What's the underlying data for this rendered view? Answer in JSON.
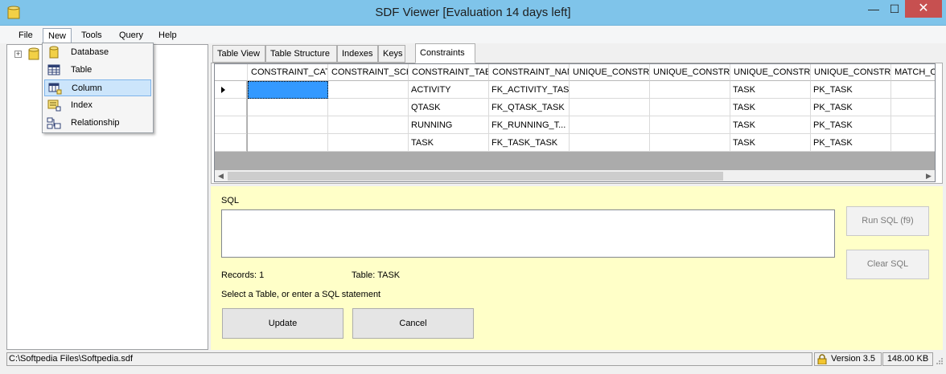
{
  "window": {
    "title": "SDF Viewer [Evaluation 14 days left]",
    "minimize": "—",
    "maximize": "☐",
    "close": "✕"
  },
  "menu": {
    "file": "File",
    "new": "New",
    "tools": "Tools",
    "query": "Query",
    "help": "Help"
  },
  "new_menu": {
    "items": [
      "Database",
      "Table",
      "Column",
      "Index",
      "Relationship"
    ],
    "highlighted": "Column"
  },
  "tree": {
    "expander": "+"
  },
  "tabs": [
    "Table View",
    "Table Structure",
    "Indexes",
    "Keys",
    "Constraints"
  ],
  "active_tab": "Constraints",
  "grid": {
    "columns": [
      "CONSTRAINT_CATALOG",
      "CONSTRAINT_SCHEMA",
      "CONSTRAINT_TABLE_NAME",
      "CONSTRAINT_NAME",
      "UNIQUE_CONSTRAINT_CATALOG",
      "UNIQUE_CONSTRAINT_SCHEMA",
      "UNIQUE_CONSTRAINT_TABLE_NAME",
      "UNIQUE_CONSTRAINT_NAME",
      "MATCH_OPTION"
    ],
    "rows": [
      [
        "",
        "",
        "ACTIVITY",
        "FK_ACTIVITY_TASK",
        "",
        "",
        "TASK",
        "PK_TASK",
        ""
      ],
      [
        "",
        "",
        "QTASK",
        "FK_QTASK_TASK",
        "",
        "",
        "TASK",
        "PK_TASK",
        ""
      ],
      [
        "",
        "",
        "RUNNING",
        "FK_RUNNING_T...",
        "",
        "",
        "TASK",
        "PK_TASK",
        ""
      ],
      [
        "",
        "",
        "TASK",
        "FK_TASK_TASK",
        "",
        "",
        "TASK",
        "PK_TASK",
        ""
      ]
    ],
    "scroll_left": "◀",
    "scroll_right": "▶"
  },
  "sql": {
    "label": "SQL",
    "value": "",
    "run_button": "Run SQL (f9)",
    "clear_button": "Clear SQL",
    "records": "Records: 1",
    "table": "Table: TASK",
    "hint": "Select a Table, or enter a SQL statement",
    "update_button": "Update",
    "cancel_button": "Cancel"
  },
  "status": {
    "path": "C:\\Softpedia Files\\Softpedia.sdf",
    "version": "Version 3.5",
    "size": "148.00 KB"
  }
}
